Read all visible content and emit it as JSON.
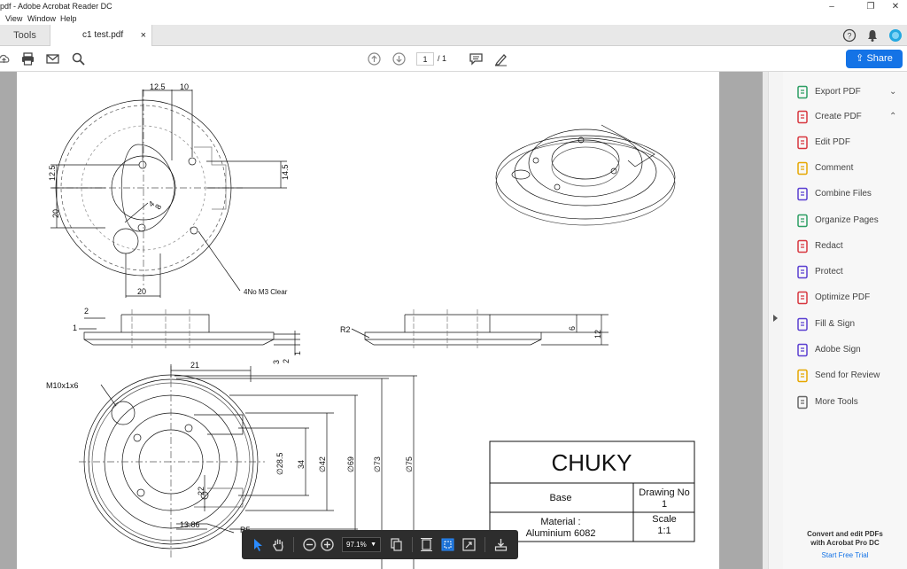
{
  "window": {
    "title": "pdf - Adobe Acrobat Reader DC",
    "minimize": "–",
    "restore": "❐",
    "close": "✕"
  },
  "menu": [
    "View",
    "Window",
    "Help"
  ],
  "tabs": {
    "tools": "Tools",
    "document": "c1 test.pdf",
    "close": "×"
  },
  "toolbar": {
    "page_current": "1",
    "page_total": "/ 1",
    "share": "Share"
  },
  "drawing": {
    "dims_top": [
      "12.5",
      "10",
      "12.5",
      "20",
      "14.5",
      "20",
      "4",
      "8"
    ],
    "callout_holes": "4No M3 Clear",
    "section_dims": [
      "2",
      "1",
      "3",
      "2",
      "1"
    ],
    "r2": "R2",
    "side_dims": [
      "6",
      "12"
    ],
    "dims_bottom": [
      "21",
      "M10x1x6",
      "∅28.5",
      "34",
      "∅42",
      "∅69",
      "∅73",
      "∅75",
      "22",
      "13.86",
      "R5"
    ]
  },
  "titleblock": {
    "name": "CHUKY",
    "part": "Base",
    "drawing_no_label": "Drawing No",
    "drawing_no": "1",
    "material_label": "Material :",
    "material": "Aluminium 6082",
    "scale_label": "Scale",
    "scale": "1:1"
  },
  "right_panel": {
    "tools": [
      {
        "label": "Export PDF",
        "icon": "export-pdf-icon",
        "color": "#2c9e63",
        "chev": "⌄"
      },
      {
        "label": "Create PDF",
        "icon": "create-pdf-icon",
        "color": "#d7373f",
        "chev": "⌃"
      },
      {
        "label": "Edit PDF",
        "icon": "edit-pdf-icon",
        "color": "#d7373f",
        "chev": ""
      },
      {
        "label": "Comment",
        "icon": "comment-icon",
        "color": "#e6a700",
        "chev": ""
      },
      {
        "label": "Combine Files",
        "icon": "combine-files-icon",
        "color": "#5a3fd1",
        "chev": ""
      },
      {
        "label": "Organize Pages",
        "icon": "organize-pages-icon",
        "color": "#2c9e63",
        "chev": ""
      },
      {
        "label": "Redact",
        "icon": "redact-icon",
        "color": "#d7373f",
        "chev": ""
      },
      {
        "label": "Protect",
        "icon": "protect-icon",
        "color": "#5a3fd1",
        "chev": ""
      },
      {
        "label": "Optimize PDF",
        "icon": "optimize-pdf-icon",
        "color": "#d7373f",
        "chev": ""
      },
      {
        "label": "Fill & Sign",
        "icon": "fill-sign-icon",
        "color": "#5a3fd1",
        "chev": ""
      },
      {
        "label": "Adobe Sign",
        "icon": "adobe-sign-icon",
        "color": "#5a3fd1",
        "chev": ""
      },
      {
        "label": "Send for Review",
        "icon": "send-review-icon",
        "color": "#e6a700",
        "chev": ""
      },
      {
        "label": "More Tools",
        "icon": "more-tools-icon",
        "color": "#666666",
        "chev": ""
      }
    ],
    "promo_line1": "Convert and edit PDFs",
    "promo_line2": "with Acrobat Pro DC",
    "promo_link": "Start Free Trial"
  },
  "floatbar": {
    "zoom": "97.1%"
  },
  "colors": {
    "accent": "#1473e6",
    "doc_bg": "#a9a9a9"
  }
}
